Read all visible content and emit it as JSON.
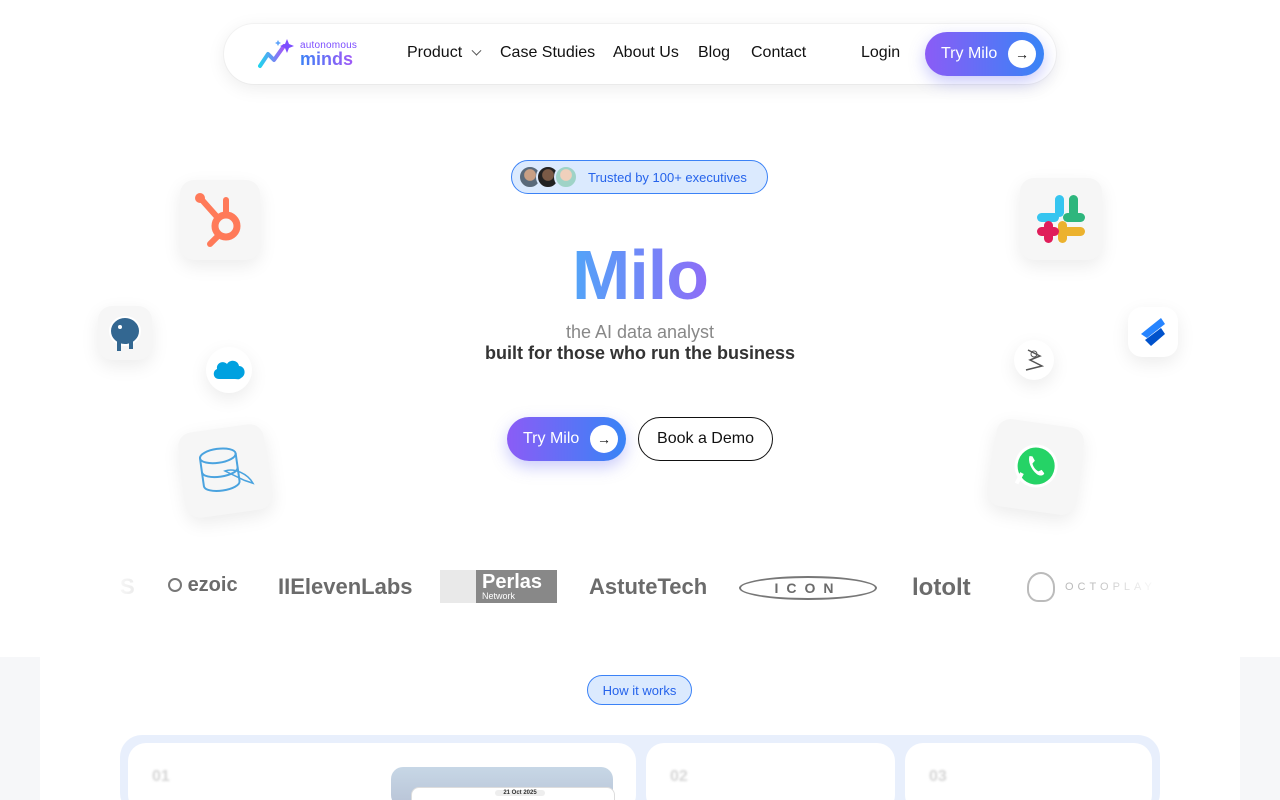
{
  "nav": {
    "logo_top": "autonomous",
    "logo_bottom": "minds",
    "links": [
      "Product",
      "Case Studies",
      "About Us",
      "Blog",
      "Contact"
    ],
    "login": "Login",
    "cta": "Try Milo"
  },
  "hero": {
    "trusted": "Trusted by 100+ executives",
    "title": "Milo",
    "subtitle_1": "the AI data analyst",
    "subtitle_2": "built for those who run the business",
    "primary_cta": "Try Milo",
    "secondary_cta": "Book a Demo"
  },
  "integrations": [
    "hubspot-icon",
    "postgresql-icon",
    "salesforce-icon",
    "mysql-icon",
    "slack-icon",
    "jira-icon",
    "spark-icon",
    "whatsapp-icon"
  ],
  "brands": [
    "S",
    "ezoic",
    "IIElevenLabs",
    "Perlas",
    "Network",
    "AstuteTech",
    "ICON",
    "lotolt",
    "OCTOPLAY"
  ],
  "how": {
    "badge": "How it works",
    "steps": [
      "01",
      "02",
      "03"
    ],
    "preview_date": "21 Oct 2025"
  },
  "colors": {
    "accent_purple": "#8b5cf6",
    "accent_blue": "#3b82f6",
    "badge_bg": "#dbeafe"
  }
}
